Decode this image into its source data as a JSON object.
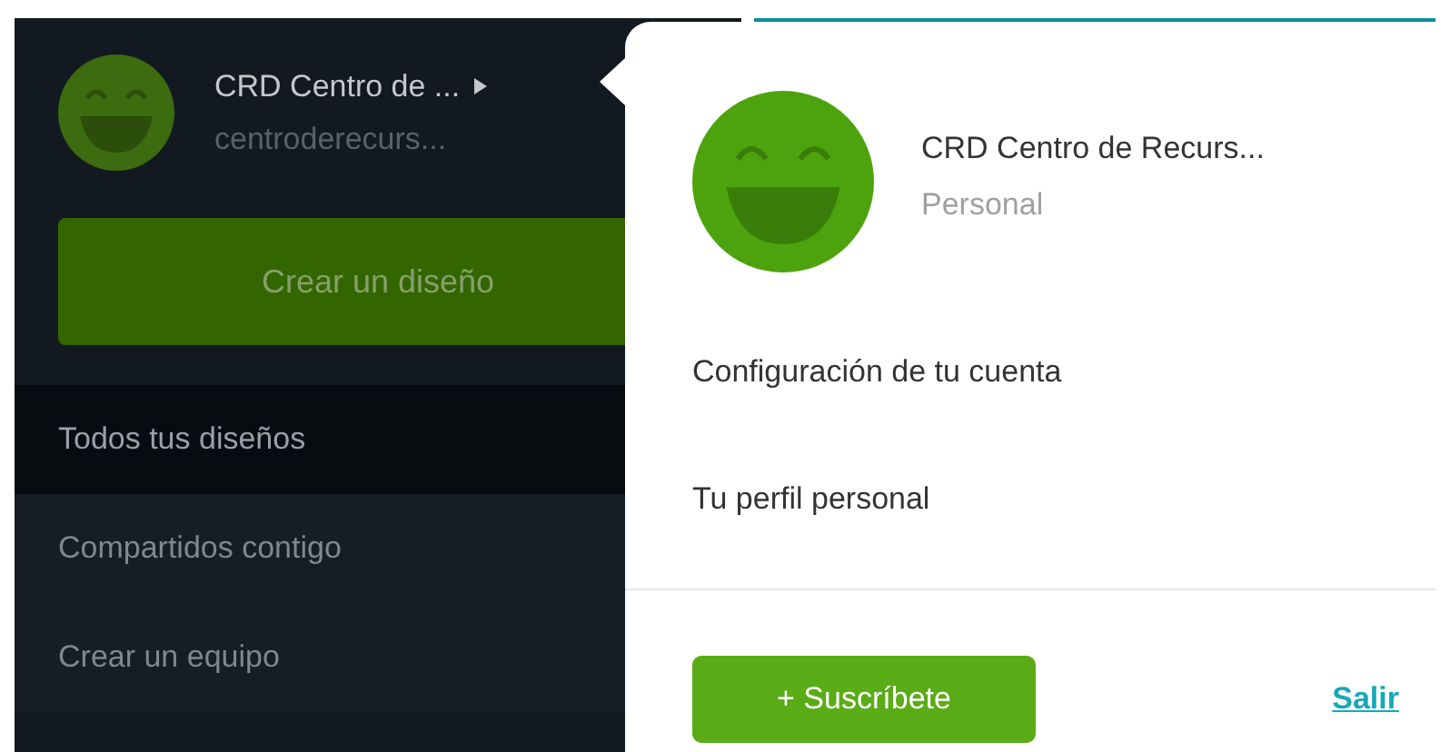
{
  "account": {
    "name": "CRD Centro de ...",
    "handle": "centroderecurs..."
  },
  "create_button": "Crear un diseño",
  "sidebar": {
    "items": [
      {
        "label": "Todos tus diseños",
        "selected": true
      },
      {
        "label": "Compartidos contigo",
        "selected": false
      },
      {
        "label": "Crear un equipo",
        "selected": false
      }
    ]
  },
  "popup": {
    "name": "CRD Centro de Recurs...",
    "plan": "Personal",
    "menu": [
      "Configuración de tu cuenta",
      "Tu perfil personal"
    ],
    "subscribe_button": "+ Suscríbete",
    "logout_link": "Salir"
  }
}
